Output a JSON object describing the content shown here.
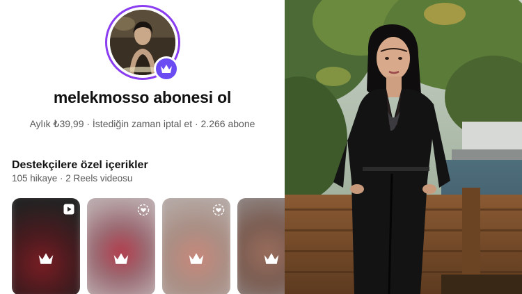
{
  "profile": {
    "title": "melekmosso abonesi ol",
    "meta": "Aylık ₺39,99 · İstediğin zaman iptal et · 2.266 abone"
  },
  "exclusive": {
    "heading": "Destekçilere özel içerikler",
    "summary": "105 hikaye · 2 Reels videosu"
  },
  "cards": [
    {
      "type": "reel",
      "corner_icon": "reels-play-icon",
      "locked_icon": "crown-icon"
    },
    {
      "type": "story",
      "corner_icon": "story-heart-icon",
      "locked_icon": "crown-icon"
    },
    {
      "type": "story",
      "corner_icon": "story-heart-icon",
      "locked_icon": "crown-icon"
    },
    {
      "type": "story",
      "corner_icon": "none",
      "locked_icon": "crown-icon"
    }
  ],
  "colors": {
    "accent_ring": "#8a3cf0",
    "badge": "#6b4cf2",
    "text_primary": "#111111",
    "text_secondary": "#595959"
  }
}
